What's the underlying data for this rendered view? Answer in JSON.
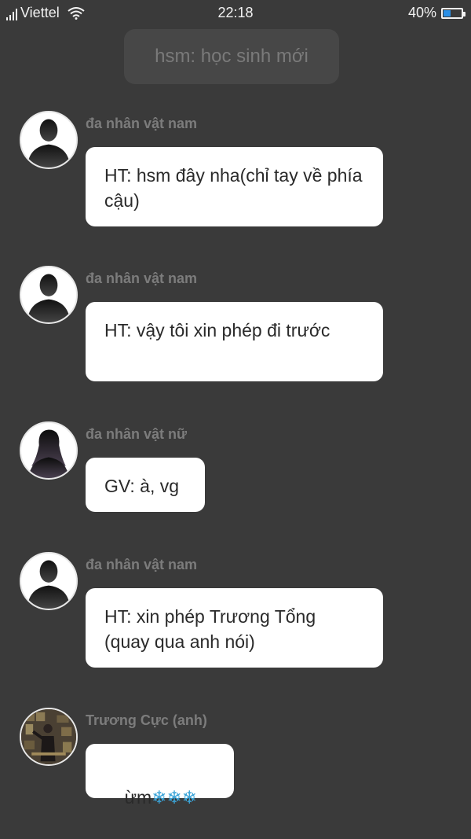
{
  "status_bar": {
    "carrier": "Viettel",
    "time": "22:18",
    "battery": "40%",
    "battery_level": 0.4
  },
  "note": "hsm: học sinh mới",
  "messages": [
    {
      "sender": "đa nhân vật nam",
      "text": "HT: hsm đây nha(chỉ tay về phía cậu)",
      "avatar": "male-silhouette"
    },
    {
      "sender": "đa nhân vật nam",
      "text": "HT: vậy tôi xin phép đi trước",
      "avatar": "male-silhouette"
    },
    {
      "sender": "đa nhân vật nữ",
      "text": "GV: à, vg",
      "avatar": "female-silhouette"
    },
    {
      "sender": "đa nhân vật nam",
      "text": "HT: xin phép Trương Tổng (quay qua anh nói)",
      "avatar": "male-silhouette"
    },
    {
      "sender": "Trương Cực (anh)",
      "text": "ừm",
      "text_suffix": "❄❄❄",
      "avatar": "photo-avatar"
    }
  ],
  "colors": {
    "background": "#3a3a3a",
    "bubble": "#ffffff",
    "sender": "#7c7c7c",
    "note_bg": "#474747"
  }
}
